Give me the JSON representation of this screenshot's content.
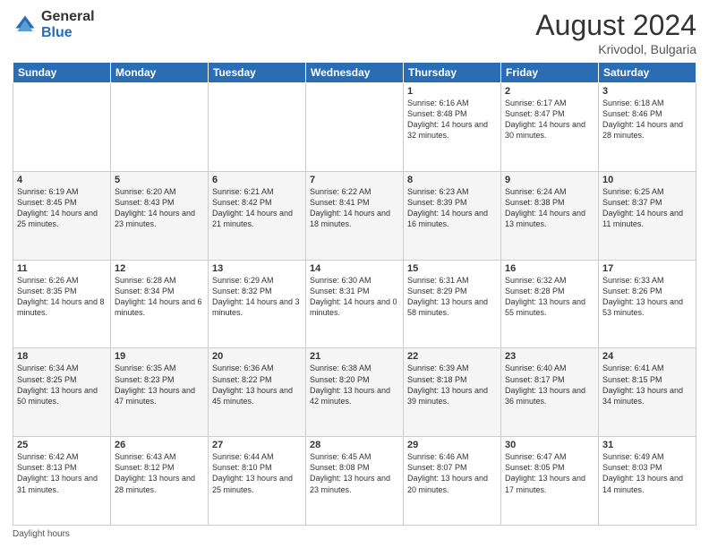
{
  "logo": {
    "general": "General",
    "blue": "Blue"
  },
  "title": "August 2024",
  "subtitle": "Krivodol, Bulgaria",
  "days_of_week": [
    "Sunday",
    "Monday",
    "Tuesday",
    "Wednesday",
    "Thursday",
    "Friday",
    "Saturday"
  ],
  "footer": "Daylight hours",
  "weeks": [
    [
      {
        "day": "",
        "info": ""
      },
      {
        "day": "",
        "info": ""
      },
      {
        "day": "",
        "info": ""
      },
      {
        "day": "",
        "info": ""
      },
      {
        "day": "1",
        "info": "Sunrise: 6:16 AM\nSunset: 8:48 PM\nDaylight: 14 hours and 32 minutes."
      },
      {
        "day": "2",
        "info": "Sunrise: 6:17 AM\nSunset: 8:47 PM\nDaylight: 14 hours and 30 minutes."
      },
      {
        "day": "3",
        "info": "Sunrise: 6:18 AM\nSunset: 8:46 PM\nDaylight: 14 hours and 28 minutes."
      }
    ],
    [
      {
        "day": "4",
        "info": "Sunrise: 6:19 AM\nSunset: 8:45 PM\nDaylight: 14 hours and 25 minutes."
      },
      {
        "day": "5",
        "info": "Sunrise: 6:20 AM\nSunset: 8:43 PM\nDaylight: 14 hours and 23 minutes."
      },
      {
        "day": "6",
        "info": "Sunrise: 6:21 AM\nSunset: 8:42 PM\nDaylight: 14 hours and 21 minutes."
      },
      {
        "day": "7",
        "info": "Sunrise: 6:22 AM\nSunset: 8:41 PM\nDaylight: 14 hours and 18 minutes."
      },
      {
        "day": "8",
        "info": "Sunrise: 6:23 AM\nSunset: 8:39 PM\nDaylight: 14 hours and 16 minutes."
      },
      {
        "day": "9",
        "info": "Sunrise: 6:24 AM\nSunset: 8:38 PM\nDaylight: 14 hours and 13 minutes."
      },
      {
        "day": "10",
        "info": "Sunrise: 6:25 AM\nSunset: 8:37 PM\nDaylight: 14 hours and 11 minutes."
      }
    ],
    [
      {
        "day": "11",
        "info": "Sunrise: 6:26 AM\nSunset: 8:35 PM\nDaylight: 14 hours and 8 minutes."
      },
      {
        "day": "12",
        "info": "Sunrise: 6:28 AM\nSunset: 8:34 PM\nDaylight: 14 hours and 6 minutes."
      },
      {
        "day": "13",
        "info": "Sunrise: 6:29 AM\nSunset: 8:32 PM\nDaylight: 14 hours and 3 minutes."
      },
      {
        "day": "14",
        "info": "Sunrise: 6:30 AM\nSunset: 8:31 PM\nDaylight: 14 hours and 0 minutes."
      },
      {
        "day": "15",
        "info": "Sunrise: 6:31 AM\nSunset: 8:29 PM\nDaylight: 13 hours and 58 minutes."
      },
      {
        "day": "16",
        "info": "Sunrise: 6:32 AM\nSunset: 8:28 PM\nDaylight: 13 hours and 55 minutes."
      },
      {
        "day": "17",
        "info": "Sunrise: 6:33 AM\nSunset: 8:26 PM\nDaylight: 13 hours and 53 minutes."
      }
    ],
    [
      {
        "day": "18",
        "info": "Sunrise: 6:34 AM\nSunset: 8:25 PM\nDaylight: 13 hours and 50 minutes."
      },
      {
        "day": "19",
        "info": "Sunrise: 6:35 AM\nSunset: 8:23 PM\nDaylight: 13 hours and 47 minutes."
      },
      {
        "day": "20",
        "info": "Sunrise: 6:36 AM\nSunset: 8:22 PM\nDaylight: 13 hours and 45 minutes."
      },
      {
        "day": "21",
        "info": "Sunrise: 6:38 AM\nSunset: 8:20 PM\nDaylight: 13 hours and 42 minutes."
      },
      {
        "day": "22",
        "info": "Sunrise: 6:39 AM\nSunset: 8:18 PM\nDaylight: 13 hours and 39 minutes."
      },
      {
        "day": "23",
        "info": "Sunrise: 6:40 AM\nSunset: 8:17 PM\nDaylight: 13 hours and 36 minutes."
      },
      {
        "day": "24",
        "info": "Sunrise: 6:41 AM\nSunset: 8:15 PM\nDaylight: 13 hours and 34 minutes."
      }
    ],
    [
      {
        "day": "25",
        "info": "Sunrise: 6:42 AM\nSunset: 8:13 PM\nDaylight: 13 hours and 31 minutes."
      },
      {
        "day": "26",
        "info": "Sunrise: 6:43 AM\nSunset: 8:12 PM\nDaylight: 13 hours and 28 minutes."
      },
      {
        "day": "27",
        "info": "Sunrise: 6:44 AM\nSunset: 8:10 PM\nDaylight: 13 hours and 25 minutes."
      },
      {
        "day": "28",
        "info": "Sunrise: 6:45 AM\nSunset: 8:08 PM\nDaylight: 13 hours and 23 minutes."
      },
      {
        "day": "29",
        "info": "Sunrise: 6:46 AM\nSunset: 8:07 PM\nDaylight: 13 hours and 20 minutes."
      },
      {
        "day": "30",
        "info": "Sunrise: 6:47 AM\nSunset: 8:05 PM\nDaylight: 13 hours and 17 minutes."
      },
      {
        "day": "31",
        "info": "Sunrise: 6:49 AM\nSunset: 8:03 PM\nDaylight: 13 hours and 14 minutes."
      }
    ]
  ]
}
